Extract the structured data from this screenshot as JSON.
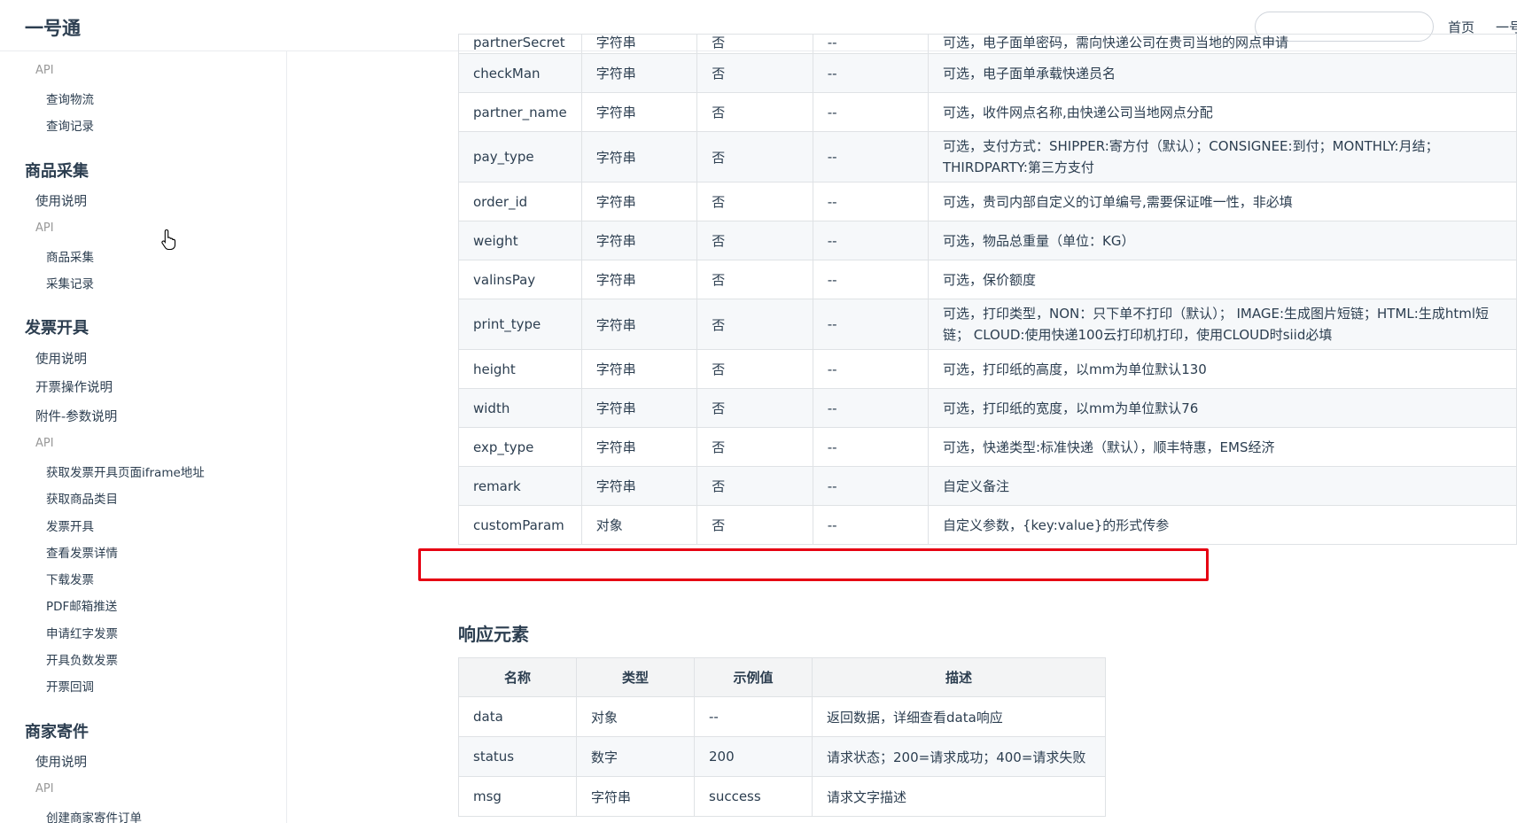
{
  "header": {
    "logo": "一号通",
    "search_placeholder": "",
    "nav": [
      "首页",
      "一号"
    ]
  },
  "sidebar": {
    "top_api_label": "API",
    "top_items": [
      "查询物流",
      "查询记录"
    ],
    "groups": [
      {
        "title": "商品采集",
        "links": [
          "使用说明"
        ],
        "api_label": "API",
        "sub": [
          "商品采集",
          "采集记录"
        ]
      },
      {
        "title": "发票开具",
        "links": [
          "使用说明",
          "开票操作说明",
          "附件-参数说明"
        ],
        "api_label": "API",
        "sub": [
          "获取发票开具页面iframe地址",
          "获取商品类目",
          "发票开具",
          "查看发票详情",
          "下载发票",
          "PDF邮箱推送",
          "申请红字发票",
          "开具负数发票",
          "开票回调"
        ]
      },
      {
        "title": "商家寄件",
        "links": [
          "使用说明"
        ],
        "api_label": "API",
        "sub": [
          "创建商家寄件订单"
        ]
      }
    ]
  },
  "params_table": {
    "rows": [
      [
        "partnerSecret",
        "字符串",
        "否",
        "--",
        "可选，电子面单密码，需向快递公司在贵司当地的网点申请"
      ],
      [
        "checkMan",
        "字符串",
        "否",
        "--",
        "可选，电子面单承载快递员名"
      ],
      [
        "partner_name",
        "字符串",
        "否",
        "--",
        "可选，收件网点名称,由快递公司当地网点分配"
      ],
      [
        "pay_type",
        "字符串",
        "否",
        "--",
        "可选，支付方式：SHIPPER:寄方付（默认）；CONSIGNEE:到付；MONTHLY:月结；THIRDPARTY:第三方支付"
      ],
      [
        "order_id",
        "字符串",
        "否",
        "--",
        "可选，贵司内部自定义的订单编号,需要保证唯一性，非必填"
      ],
      [
        "weight",
        "字符串",
        "否",
        "--",
        "可选，物品总重量（单位：KG）"
      ],
      [
        "valinsPay",
        "字符串",
        "否",
        "--",
        "可选，保价额度"
      ],
      [
        "print_type",
        "字符串",
        "否",
        "--",
        "可选，打印类型，NON：只下单不打印（默认）； IMAGE:生成图片短链；HTML:生成html短链； CLOUD:使用快递100云打印机打印，使用CLOUD时siid必填"
      ],
      [
        "height",
        "字符串",
        "否",
        "--",
        "可选，打印纸的高度，以mm为单位默认130"
      ],
      [
        "width",
        "字符串",
        "否",
        "--",
        "可选，打印纸的宽度，以mm为单位默认76"
      ],
      [
        "exp_type",
        "字符串",
        "否",
        "--",
        "可选，快递类型:标准快递（默认），顺丰特惠，EMS经济"
      ],
      [
        "remark",
        "字符串",
        "否",
        "--",
        "自定义备注"
      ],
      [
        "customParam",
        "对象",
        "否",
        "--",
        "自定义参数，{key:value}的形式传参"
      ]
    ]
  },
  "response": {
    "title": "响应元素",
    "headers": [
      "名称",
      "类型",
      "示例值",
      "描述"
    ],
    "rows": [
      [
        "data",
        "对象",
        "--",
        "返回数据，详细查看data响应"
      ],
      [
        "status",
        "数字",
        "200",
        "请求状态；200=请求成功；400=请求失败"
      ],
      [
        "msg",
        "字符串",
        "success",
        "请求文字描述"
      ]
    ]
  }
}
